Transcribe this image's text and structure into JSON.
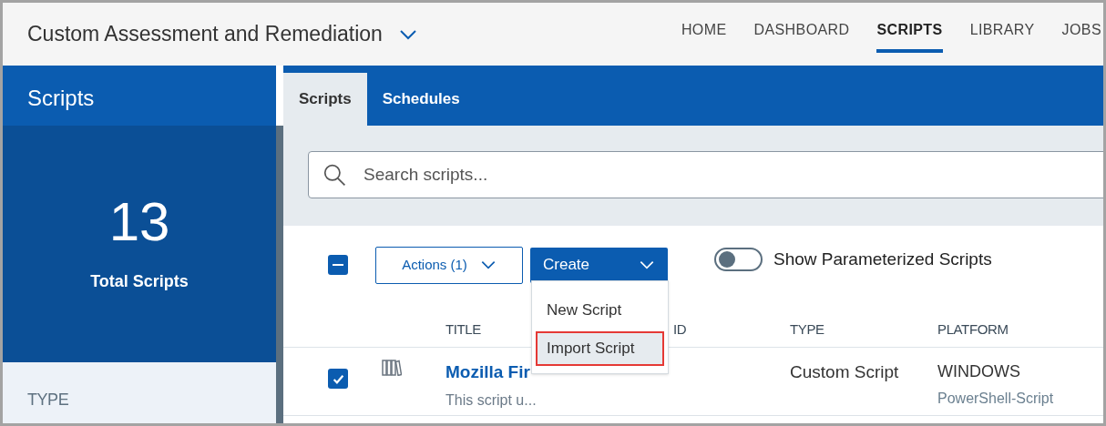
{
  "header": {
    "title": "Custom Assessment and Remediation",
    "nav": [
      {
        "label": "HOME",
        "selected": false
      },
      {
        "label": "DASHBOARD",
        "selected": false
      },
      {
        "label": "SCRIPTS",
        "selected": true
      },
      {
        "label": "LIBRARY",
        "selected": false
      },
      {
        "label": "JOBS",
        "selected": false
      }
    ]
  },
  "sidebar": {
    "title": "Scripts",
    "count": "13",
    "count_label": "Total Scripts",
    "filter_heading": "TYPE"
  },
  "tabs": [
    {
      "label": "Scripts",
      "selected": true
    },
    {
      "label": "Schedules",
      "selected": false
    }
  ],
  "search": {
    "placeholder": "Search scripts..."
  },
  "toolbar": {
    "select_all": {
      "indeterminate": true
    },
    "actions_label": "Actions (1)",
    "create_label": "Create",
    "toggle": {
      "label": "Show Parameterized Scripts",
      "on": false
    }
  },
  "create_menu": [
    {
      "label": "New Script",
      "selected": false
    },
    {
      "label": "Import Script",
      "selected": true
    }
  ],
  "table": {
    "columns": [
      "TITLE",
      "ID",
      "TYPE",
      "PLATFORM"
    ],
    "rows": [
      {
        "checked": true,
        "title": "Mozilla Fir",
        "description": "This script u...",
        "type": "Custom Script",
        "platform": "WINDOWS",
        "platform_detail": "PowerShell-Script"
      }
    ]
  }
}
